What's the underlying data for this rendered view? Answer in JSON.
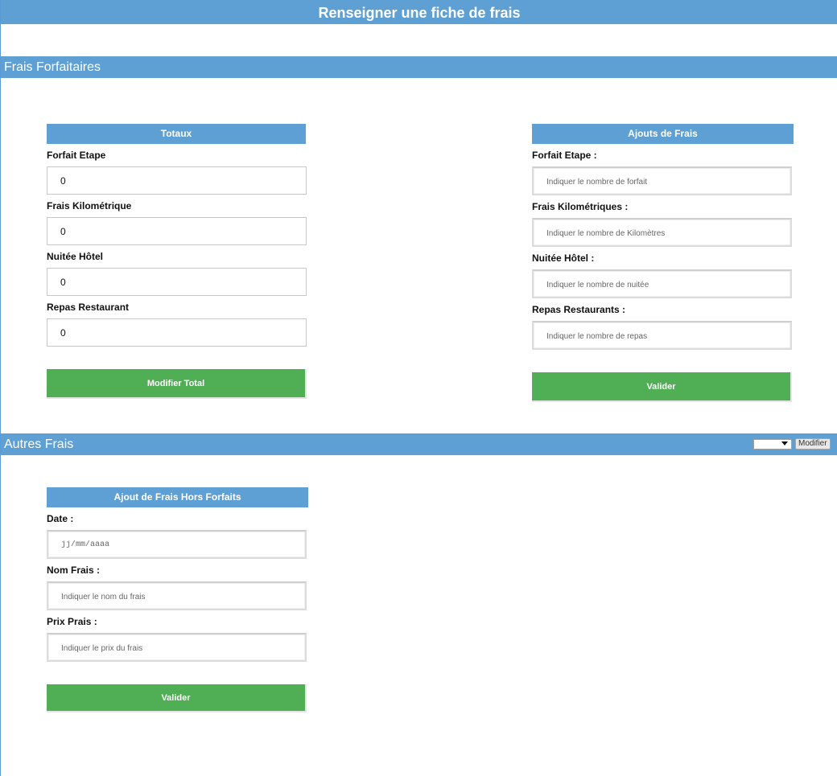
{
  "page": {
    "title": "Renseigner une fiche de frais"
  },
  "forfait_section": {
    "title": "Frais Forfaitaires",
    "totals": {
      "header": "Totaux",
      "fields": [
        {
          "label": "Forfait Etape",
          "value": "0"
        },
        {
          "label": "Frais Kilométrique",
          "value": "0"
        },
        {
          "label": "Nuitée Hôtel",
          "value": "0"
        },
        {
          "label": "Repas Restaurant",
          "value": "0"
        }
      ],
      "button_label": "Modifier Total"
    },
    "add": {
      "header": "Ajouts de Frais",
      "fields": [
        {
          "label": "Forfait Etape :",
          "placeholder": "Indiquer le nombre de forfait"
        },
        {
          "label": "Frais Kilométriques :",
          "placeholder": "Indiquer le nombre de Kilomètres"
        },
        {
          "label": "Nuitée Hôtel :",
          "placeholder": "Indiquer le nombre de nuitée"
        },
        {
          "label": "Repas Restaurants :",
          "placeholder": "Indiquer le nombre de repas"
        }
      ],
      "button_label": "Valider"
    }
  },
  "autres_section": {
    "title": "Autres Frais",
    "select_value": "",
    "modify_label": "Modifier",
    "hors_forfait": {
      "header": "Ajout de Frais Hors Forfaits",
      "date": {
        "label": "Date :",
        "placeholder": "jj/mm/aaaa"
      },
      "name": {
        "label": "Nom Frais :",
        "placeholder": "Indiquer le nom du frais"
      },
      "price": {
        "label": "Prix Prais :",
        "placeholder": "Indiquer le prix du frais"
      },
      "button_label": "Valider"
    }
  },
  "colors": {
    "header_blue": "#5fa0d4",
    "button_green": "#50ae55"
  }
}
